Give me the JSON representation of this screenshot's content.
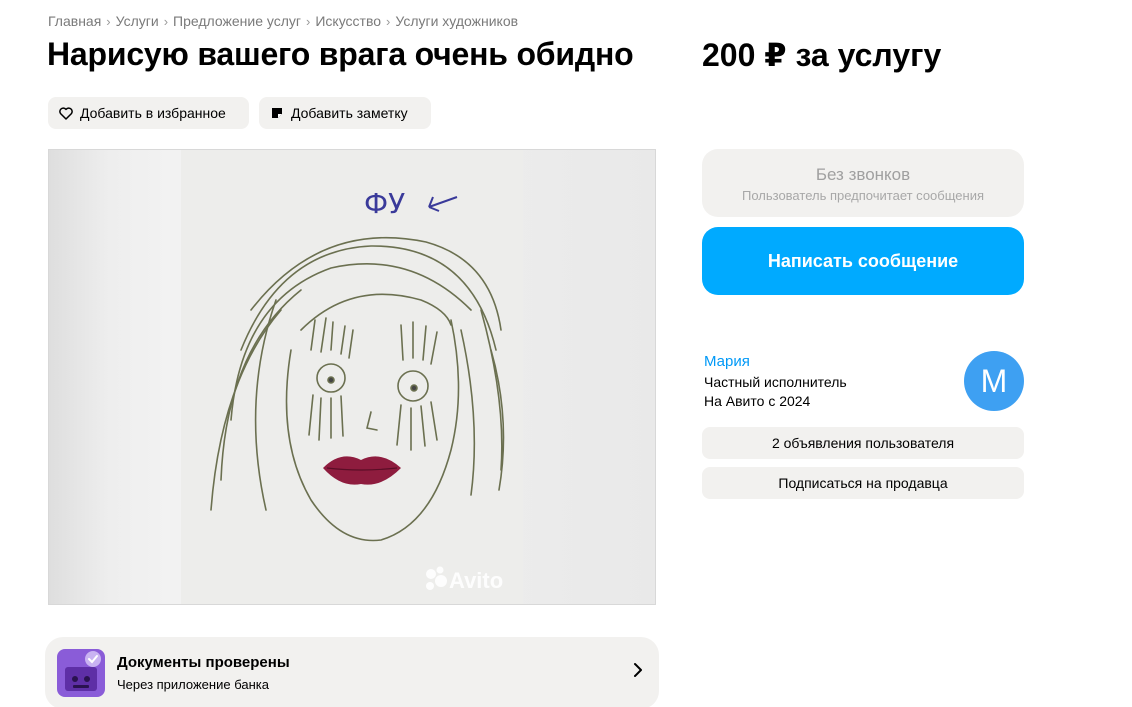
{
  "breadcrumb": [
    "Главная",
    "Услуги",
    "Предложение услуг",
    "Искусство",
    "Услуги художников"
  ],
  "title": "Нарисую вашего врага очень обидно",
  "price": "200 ₽ за услугу",
  "actions": {
    "favorite_label": "Добавить в избранное",
    "note_label": "Добавить заметку"
  },
  "gallery": {
    "handwritten_text": "ФУ",
    "watermark": "Avito"
  },
  "docs_verified": {
    "title": "Документы проверены",
    "subtitle": "Через приложение банка"
  },
  "contact": {
    "no_calls_title": "Без звонков",
    "no_calls_subtitle": "Пользователь предпочитает сообщения",
    "message_button": "Написать сообщение"
  },
  "seller": {
    "name": "Мария",
    "type": "Частный исполнитель",
    "since": "На Авито с 2024",
    "avatar_letter": "М",
    "ads_button": "2 объявления пользователя",
    "subscribe_button": "Подписаться на продавца"
  },
  "colors": {
    "accent_blue": "#00aaff",
    "link_blue": "#0099f7",
    "avatar_blue": "#3ea0f2",
    "chip_bg": "#f2f1ef",
    "badge_purple": "#8a5cd8"
  },
  "icons": [
    "heart-icon",
    "note-icon",
    "verified-badge-icon",
    "chevron-right-icon",
    "avito-logo-icon"
  ]
}
